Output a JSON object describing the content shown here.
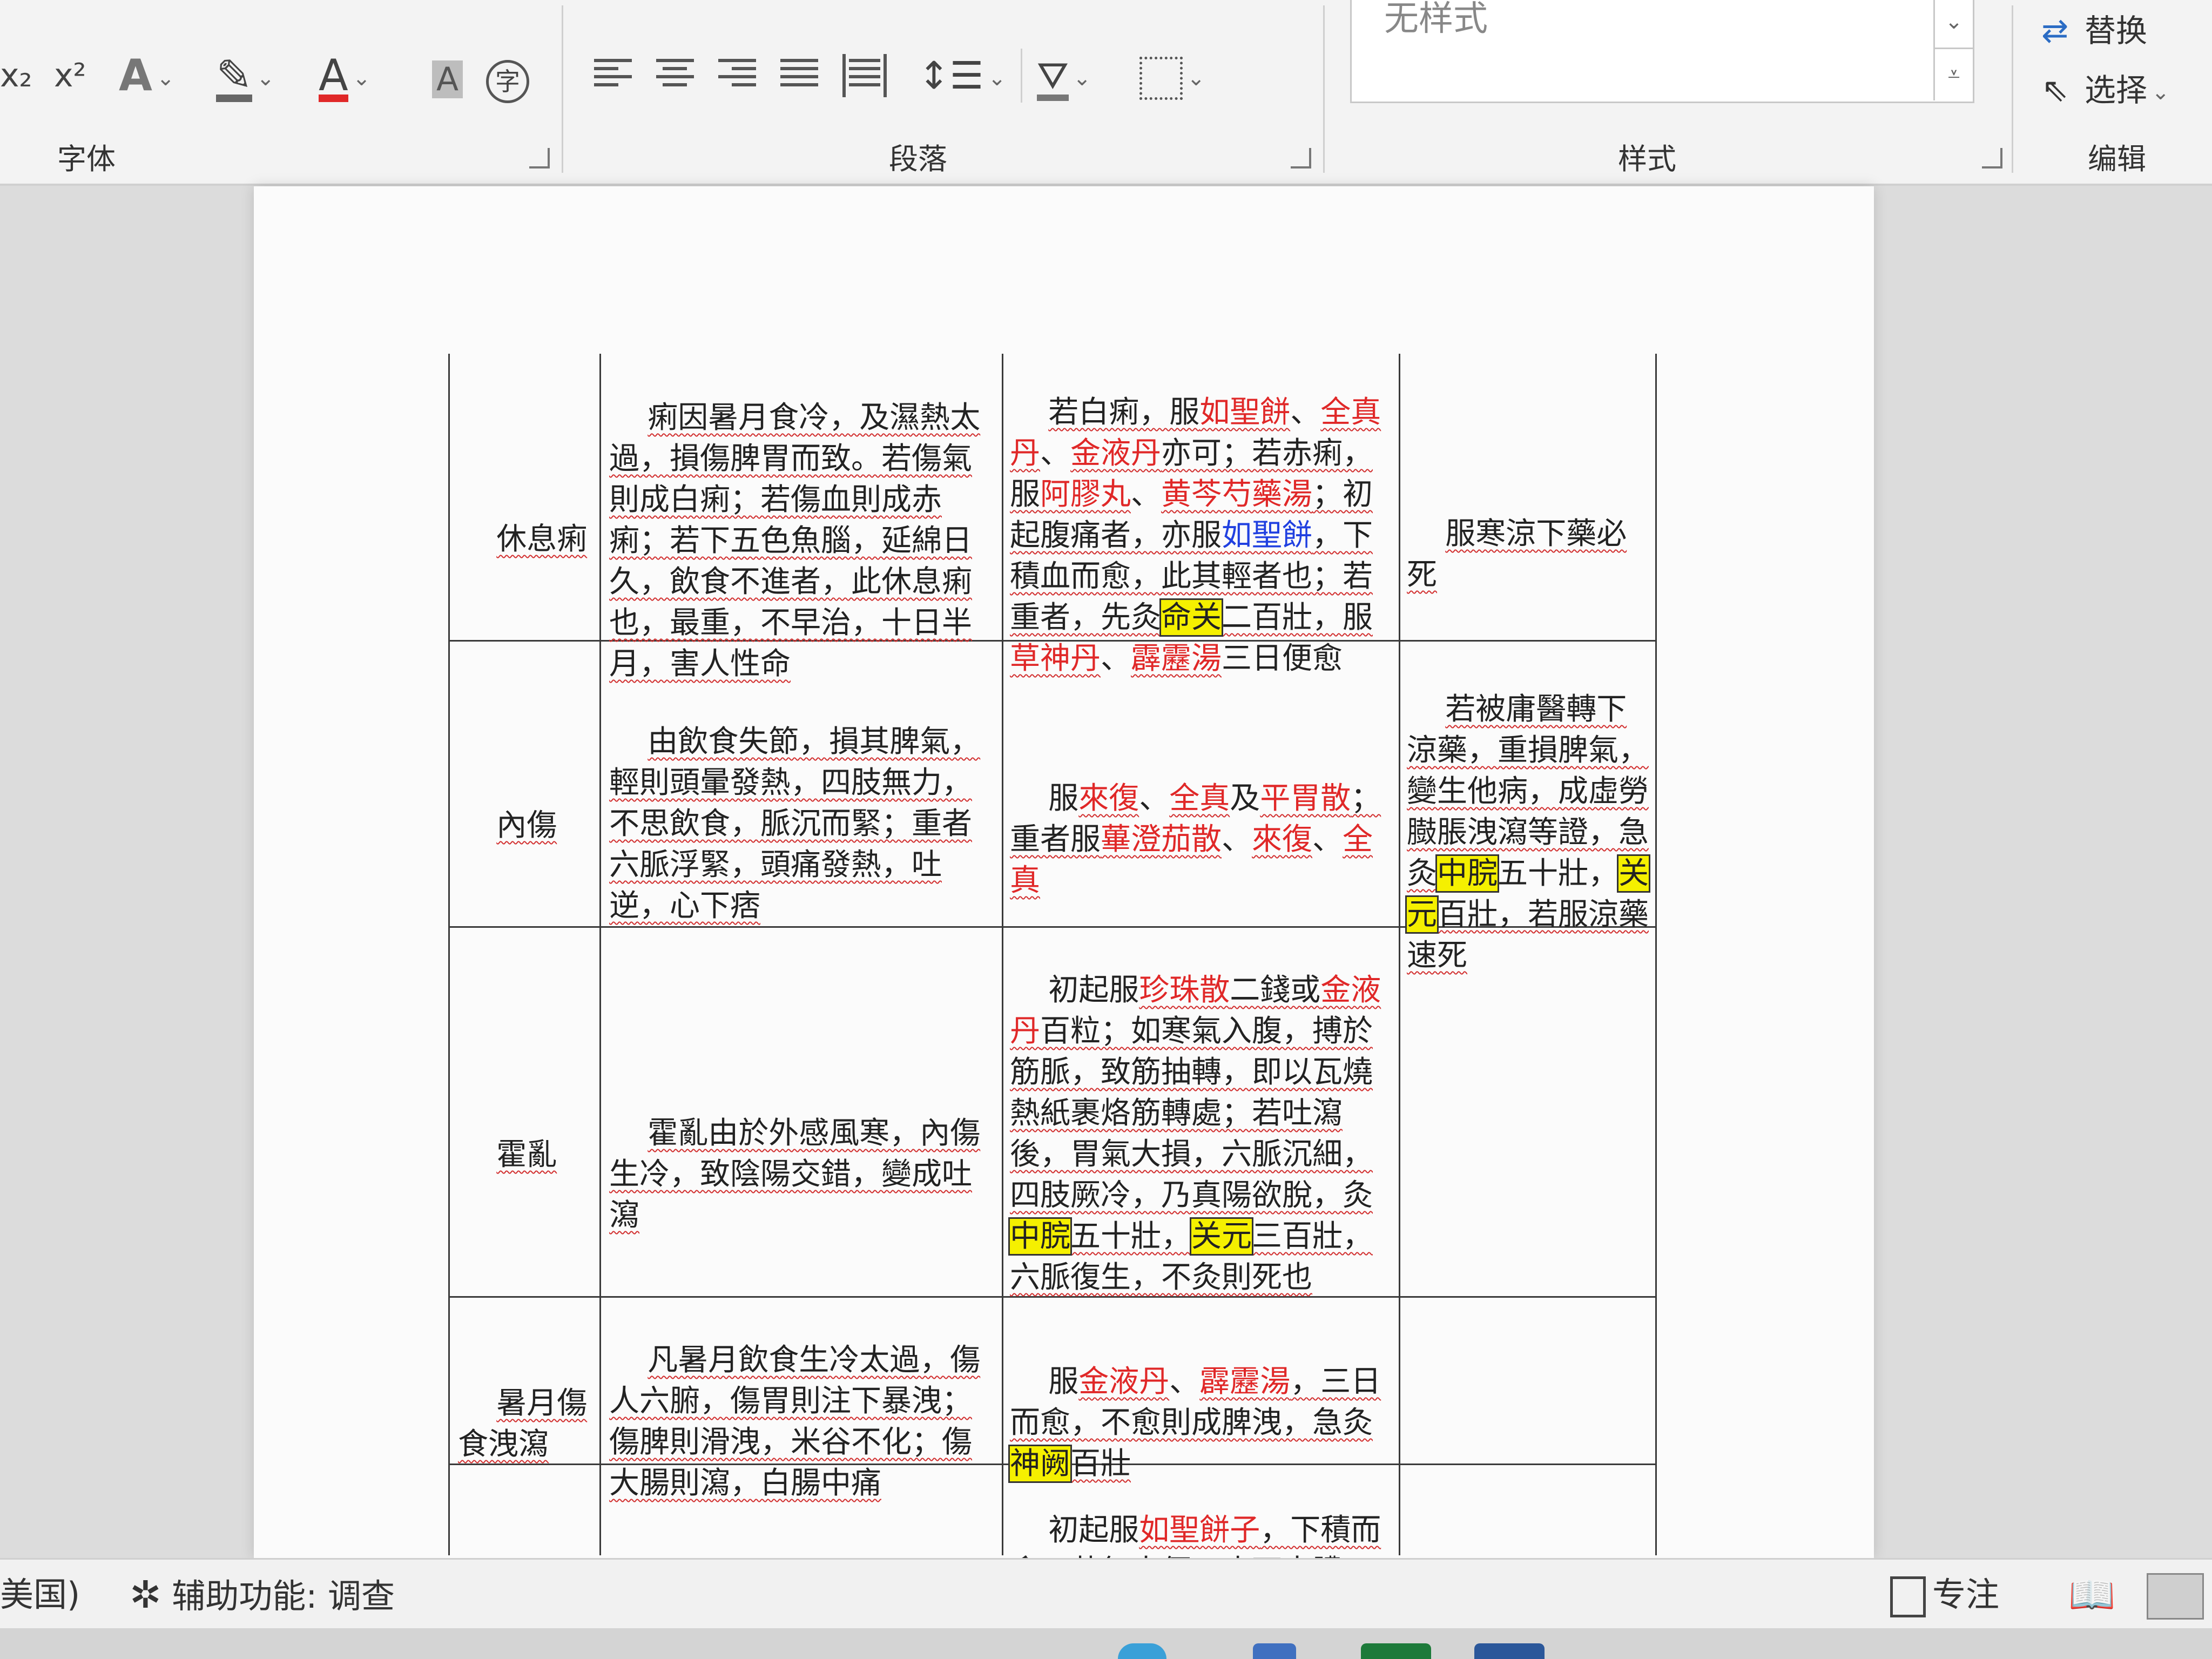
{
  "ribbon": {
    "font_group": {
      "label": "字体",
      "subscript": "x₂",
      "superscript": "x²",
      "text_effect": "A",
      "font_color": "A",
      "char_shading": "A",
      "enclose_char": "字"
    },
    "paragraph_group": {
      "label": "段落"
    },
    "styles_group": {
      "label": "样式",
      "current_style": "无样式"
    },
    "edit_group": {
      "label": "编辑",
      "replace": "替换",
      "select": "选择"
    }
  },
  "document": {
    "rows": [
      {
        "label": "休息痢",
        "cause": "痢因暑月食冷，及濕熱太過，損傷脾胃而致。若傷氣則成白痢；若傷血則成赤痢；若下五色魚腦，延綿日久，飲食不進者，此休息痢也，最重，不早治，十日半月，害人性命",
        "treat": {
          "p1": "若白痢，服",
          "d1": "如聖餅",
          "p2": "、",
          "d2": "全真丹",
          "p3": "、",
          "d3": "金液丹",
          "p4": "亦可；若赤痢，服",
          "d4": "阿膠丸",
          "p5": "、",
          "d5": "黄芩芍藥湯",
          "p6": "；初起腹痛者，亦服",
          "d6": "如聖餅",
          "p7": "，下積血而愈，此其輕者也；若重者，先灸",
          "h1": "命关",
          "p8": "二百壯，服",
          "d7": "草神丹",
          "p9": "、",
          "d8": "霹靂湯",
          "p10": "三日便愈"
        },
        "note": "服寒涼下藥必死"
      },
      {
        "label": "內傷",
        "cause": "由飲食失節，損其脾氣，輕則頭暈發熱，四肢無力，不思飲食，脈沉而緊；重者六脈浮緊，頭痛發熱，吐逆，心下痞",
        "treat": {
          "p1": "服",
          "d1": "來復",
          "p2": "、",
          "d2": "全真",
          "p3": "及",
          "d3": "平胃散",
          "p4": "；重者服",
          "d4": "蓽澄茄散",
          "p5": "、",
          "d5": "來復",
          "p6": "、",
          "d6": "全真"
        },
        "note": {
          "t1": "若被庸醫轉下涼藥，重損脾氣，變生他病，成虛勞臌脹洩瀉等證，急灸",
          "h1": "中脘",
          "t2": "五十壯，",
          "h2": "关元",
          "t3": "百壯，若服涼藥速死"
        }
      },
      {
        "label": "霍亂",
        "cause": "霍亂由於外感風寒，內傷生冷，致陰陽交錯，變成吐瀉",
        "treat": {
          "p1": "初起服",
          "d1": "珍珠散",
          "p2": "二錢或",
          "d2": "金液丹",
          "p3": "百粒；如寒氣入腹，搏於筋脈，致筋抽轉，即以瓦燒熱紙裹烙筋轉處；若吐瀉後，胃氣大損，六脈沉細，四肢厥冷，乃真陽欲脫，灸",
          "h1": "中脘",
          "p4": "五十壯，",
          "h2": "关元",
          "p5": "三百壯，六脈復生，不灸則死也"
        },
        "note": ""
      },
      {
        "label": "暑月傷食洩瀉",
        "cause": "凡暑月飲食生冷太過，傷人六腑，傷胃則注下暴洩；傷脾則滑洩，米谷不化；傷大腸則瀉，白腸中痛",
        "treat": {
          "p1": "服",
          "d1": "金液丹",
          "p2": "、",
          "d2": "霹靂湯",
          "p3": "，三日而愈，不愈則成脾洩，急灸",
          "h1": "神阙",
          "p4": "百壯"
        },
        "note": ""
      },
      {
        "label": "",
        "cause": "",
        "treat": {
          "p1": "初起服",
          "d1": "如聖餅子",
          "p2": "，下積而愈；若無大便，止下赤膿"
        },
        "note": ""
      }
    ]
  },
  "status": {
    "language": "美国)",
    "accessibility": "辅助功能: 调查",
    "focus": "专注"
  },
  "colors": {
    "drug_red": "#e02828",
    "drug_blue": "#2040e0",
    "acupoint_highlight": "#f5f000",
    "ribbon_bg": "#f3f3f3"
  }
}
